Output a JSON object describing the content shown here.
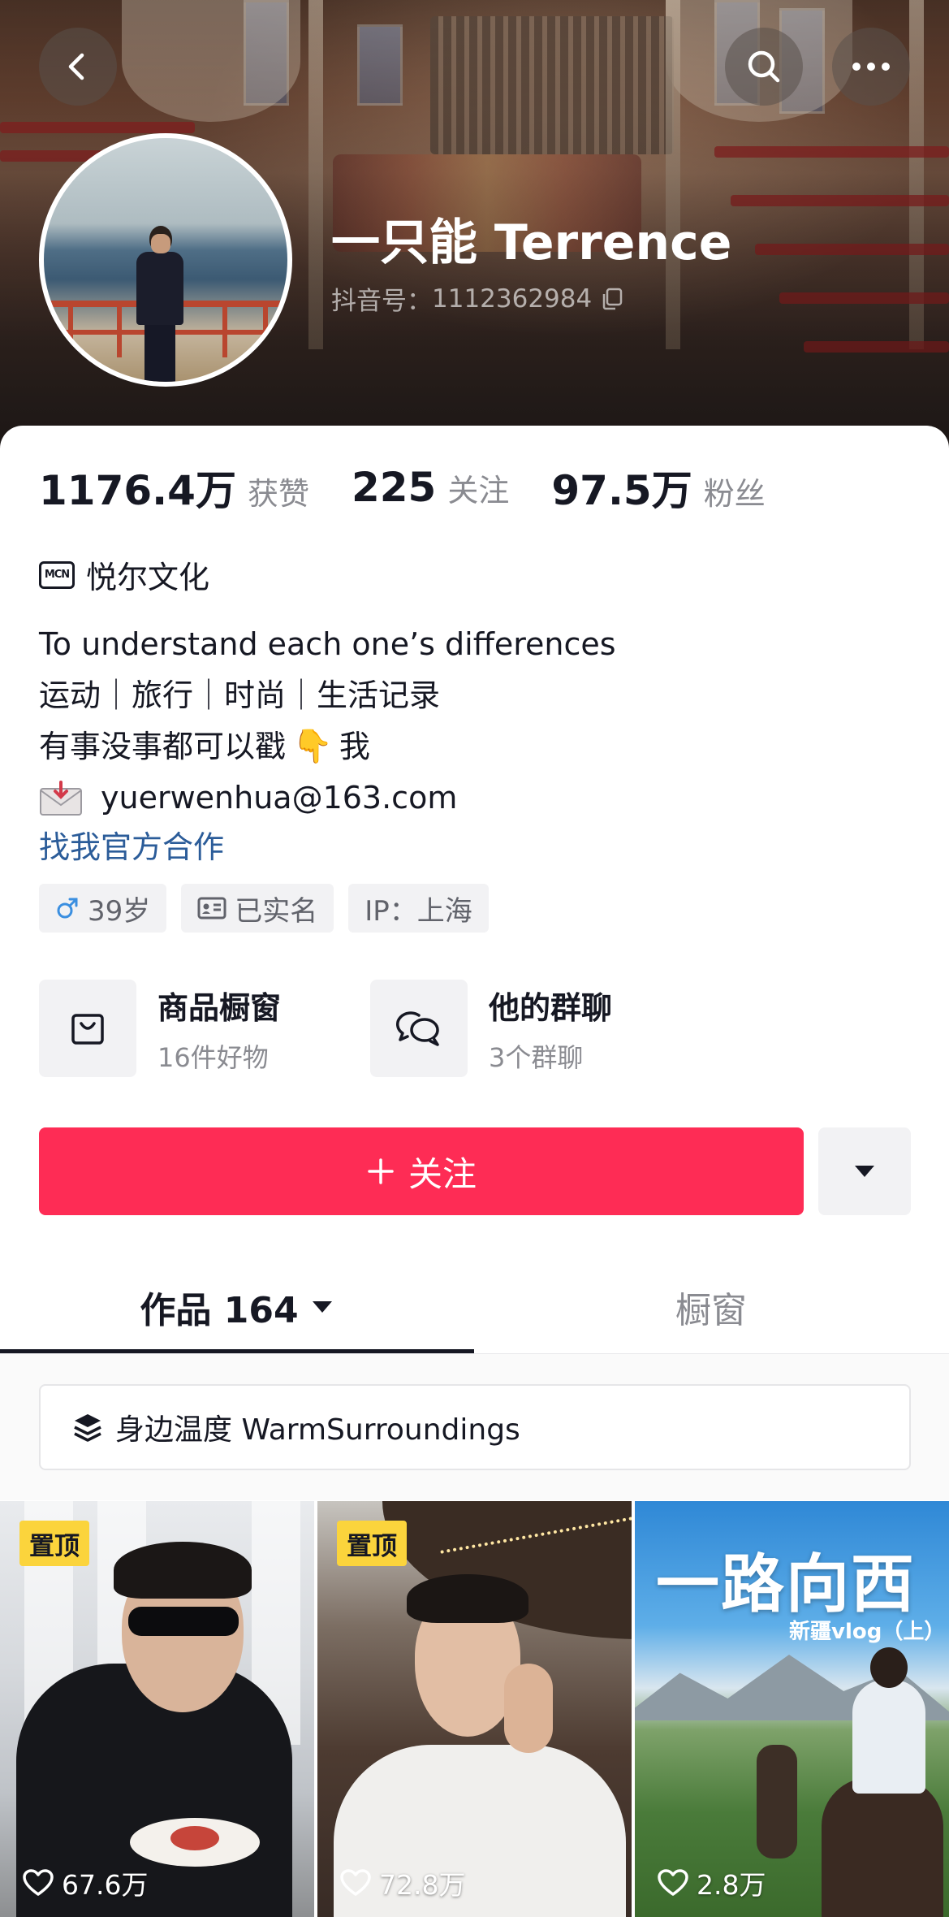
{
  "header": {
    "name": "一只能 Terrence",
    "douyin_id_label": "抖音号：",
    "douyin_id": "1112362984",
    "icons": {
      "back": "chevron-left-icon",
      "search": "search-icon",
      "more": "more-dots-icon",
      "copy": "copy-icon"
    }
  },
  "stats": [
    {
      "value": "1176.4万",
      "label": "获赞"
    },
    {
      "value": "225",
      "label": "关注"
    },
    {
      "value": "97.5万",
      "label": "粉丝"
    }
  ],
  "mcn": {
    "badge": "MCN",
    "name": "悦尔文化"
  },
  "bio": {
    "line1": "To understand each one’s differences",
    "line2": "运动｜旅行｜时尚｜生活记录",
    "line3_pre": "有事没事都可以戳",
    "line3_emoji": "👇",
    "line3_post": "我",
    "email": "yuerwenhua@163.com"
  },
  "cooperate_link": "找我官方合作",
  "tags": [
    {
      "icon": "male-icon",
      "text": "39岁"
    },
    {
      "icon": "id-card-icon",
      "text": "已实名"
    },
    {
      "text": "IP：上海"
    }
  ],
  "features": [
    {
      "icon": "shopping-bag-icon",
      "title": "商品橱窗",
      "subtitle": "16件好物"
    },
    {
      "icon": "group-chat-icon",
      "title": "他的群聊",
      "subtitle": "3个群聊"
    }
  ],
  "follow_button": {
    "label": "关注",
    "icon": "plus-icon"
  },
  "tabs": [
    {
      "label": "作品 164",
      "active": true
    },
    {
      "label": "橱窗",
      "active": false
    }
  ],
  "collection": {
    "icon": "layers-icon",
    "label": "身边温度 WarmSurroundings"
  },
  "videos": [
    {
      "pinned": "置顶",
      "likes": "67.6万"
    },
    {
      "pinned": "置顶",
      "likes": "72.8万"
    },
    {
      "overlay_title": "一路向西",
      "overlay_subtitle": "新疆vlog（上）",
      "likes": "2.8万"
    }
  ],
  "colors": {
    "accent": "#fe2c55",
    "link": "#2b5c99",
    "pin": "#fbd43c"
  }
}
